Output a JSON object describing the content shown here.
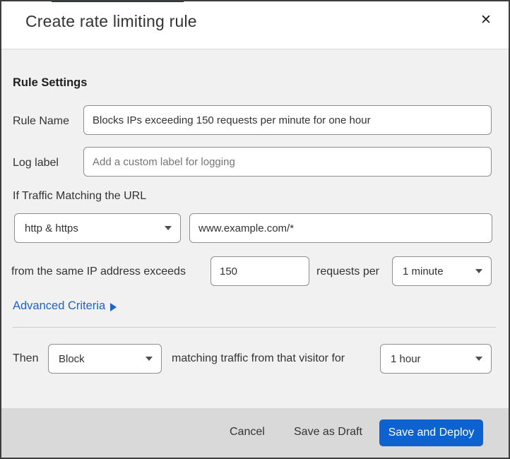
{
  "dialog": {
    "title": "Create rate limiting rule",
    "close_icon": "✕"
  },
  "form": {
    "section_heading": "Rule Settings",
    "rule_name": {
      "label": "Rule Name",
      "value": "Blocks IPs exceeding 150 requests per minute for one hour"
    },
    "log_label": {
      "label": "Log label",
      "placeholder": "Add a custom label for logging"
    },
    "traffic_match": {
      "label": "If Traffic Matching the URL",
      "scheme_select": {
        "value": "http & https"
      },
      "url_input": {
        "value": "www.example.com/*"
      }
    },
    "threshold": {
      "prefix": "from the same IP address exceeds",
      "requests_value": "150",
      "middle": "requests per",
      "period_select": {
        "value": "1 minute"
      }
    },
    "advanced_criteria": {
      "label": "Advanced Criteria"
    },
    "action": {
      "prefix": "Then",
      "action_select": {
        "value": "Block"
      },
      "middle": "matching traffic from that visitor for",
      "duration_select": {
        "value": "1 hour"
      }
    }
  },
  "footer": {
    "cancel_label": "Cancel",
    "save_draft_label": "Save as Draft",
    "save_deploy_label": "Save and Deploy"
  },
  "colors": {
    "accent_blue": "#0e62d0",
    "link_blue": "#1f62c9",
    "top_accent_navy": "#1d3160",
    "body_bg": "#f1f1f1",
    "footer_bg": "#d9d9d9"
  }
}
